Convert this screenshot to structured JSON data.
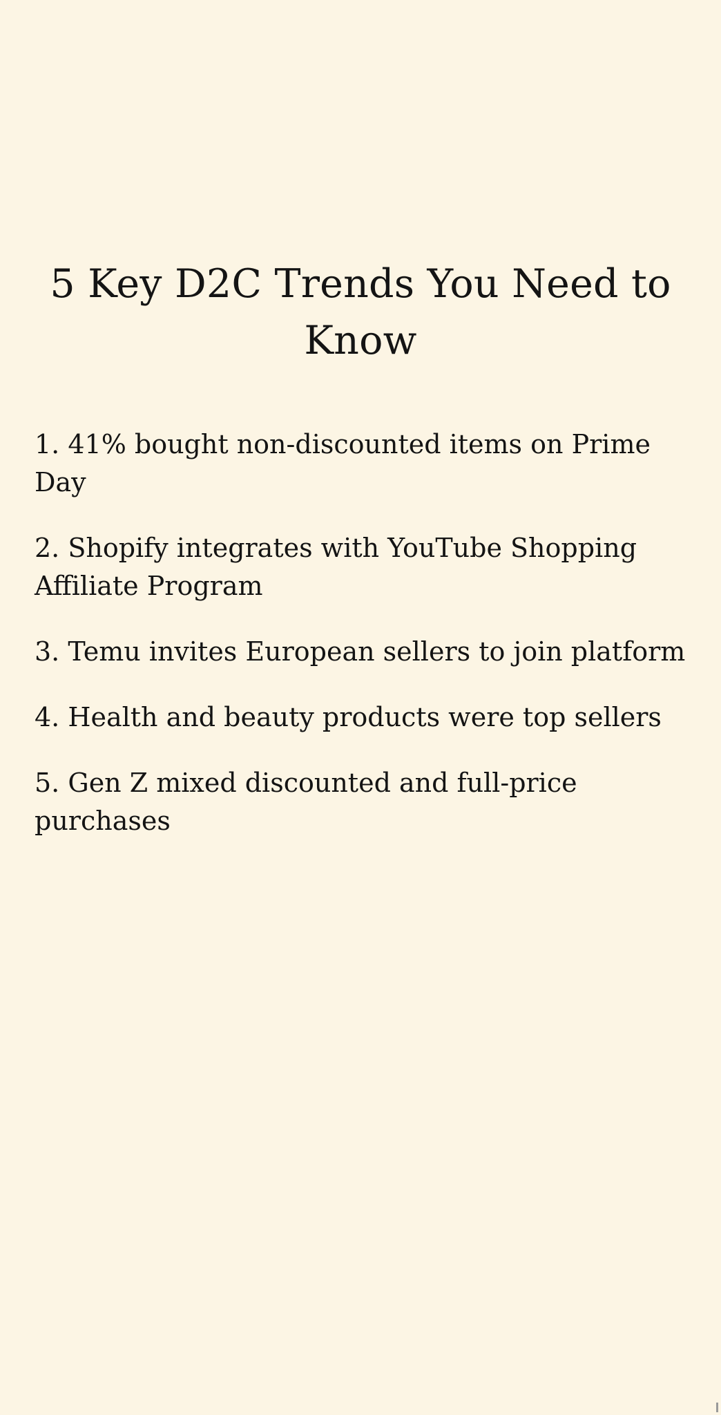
{
  "title": "5 Key D2C Trends You Need to Know",
  "items": [
    "1. 41% bought non-discounted items on Prime Day",
    "2. Shopify integrates with YouTube Shopping Affiliate Program",
    "3. Temu invites European sellers to join platform",
    "4. Health and beauty products were top sellers",
    "5. Gen Z mixed discounted and full-price purchases"
  ],
  "colors": {
    "background": "#fcf5e4",
    "text": "#141414"
  }
}
